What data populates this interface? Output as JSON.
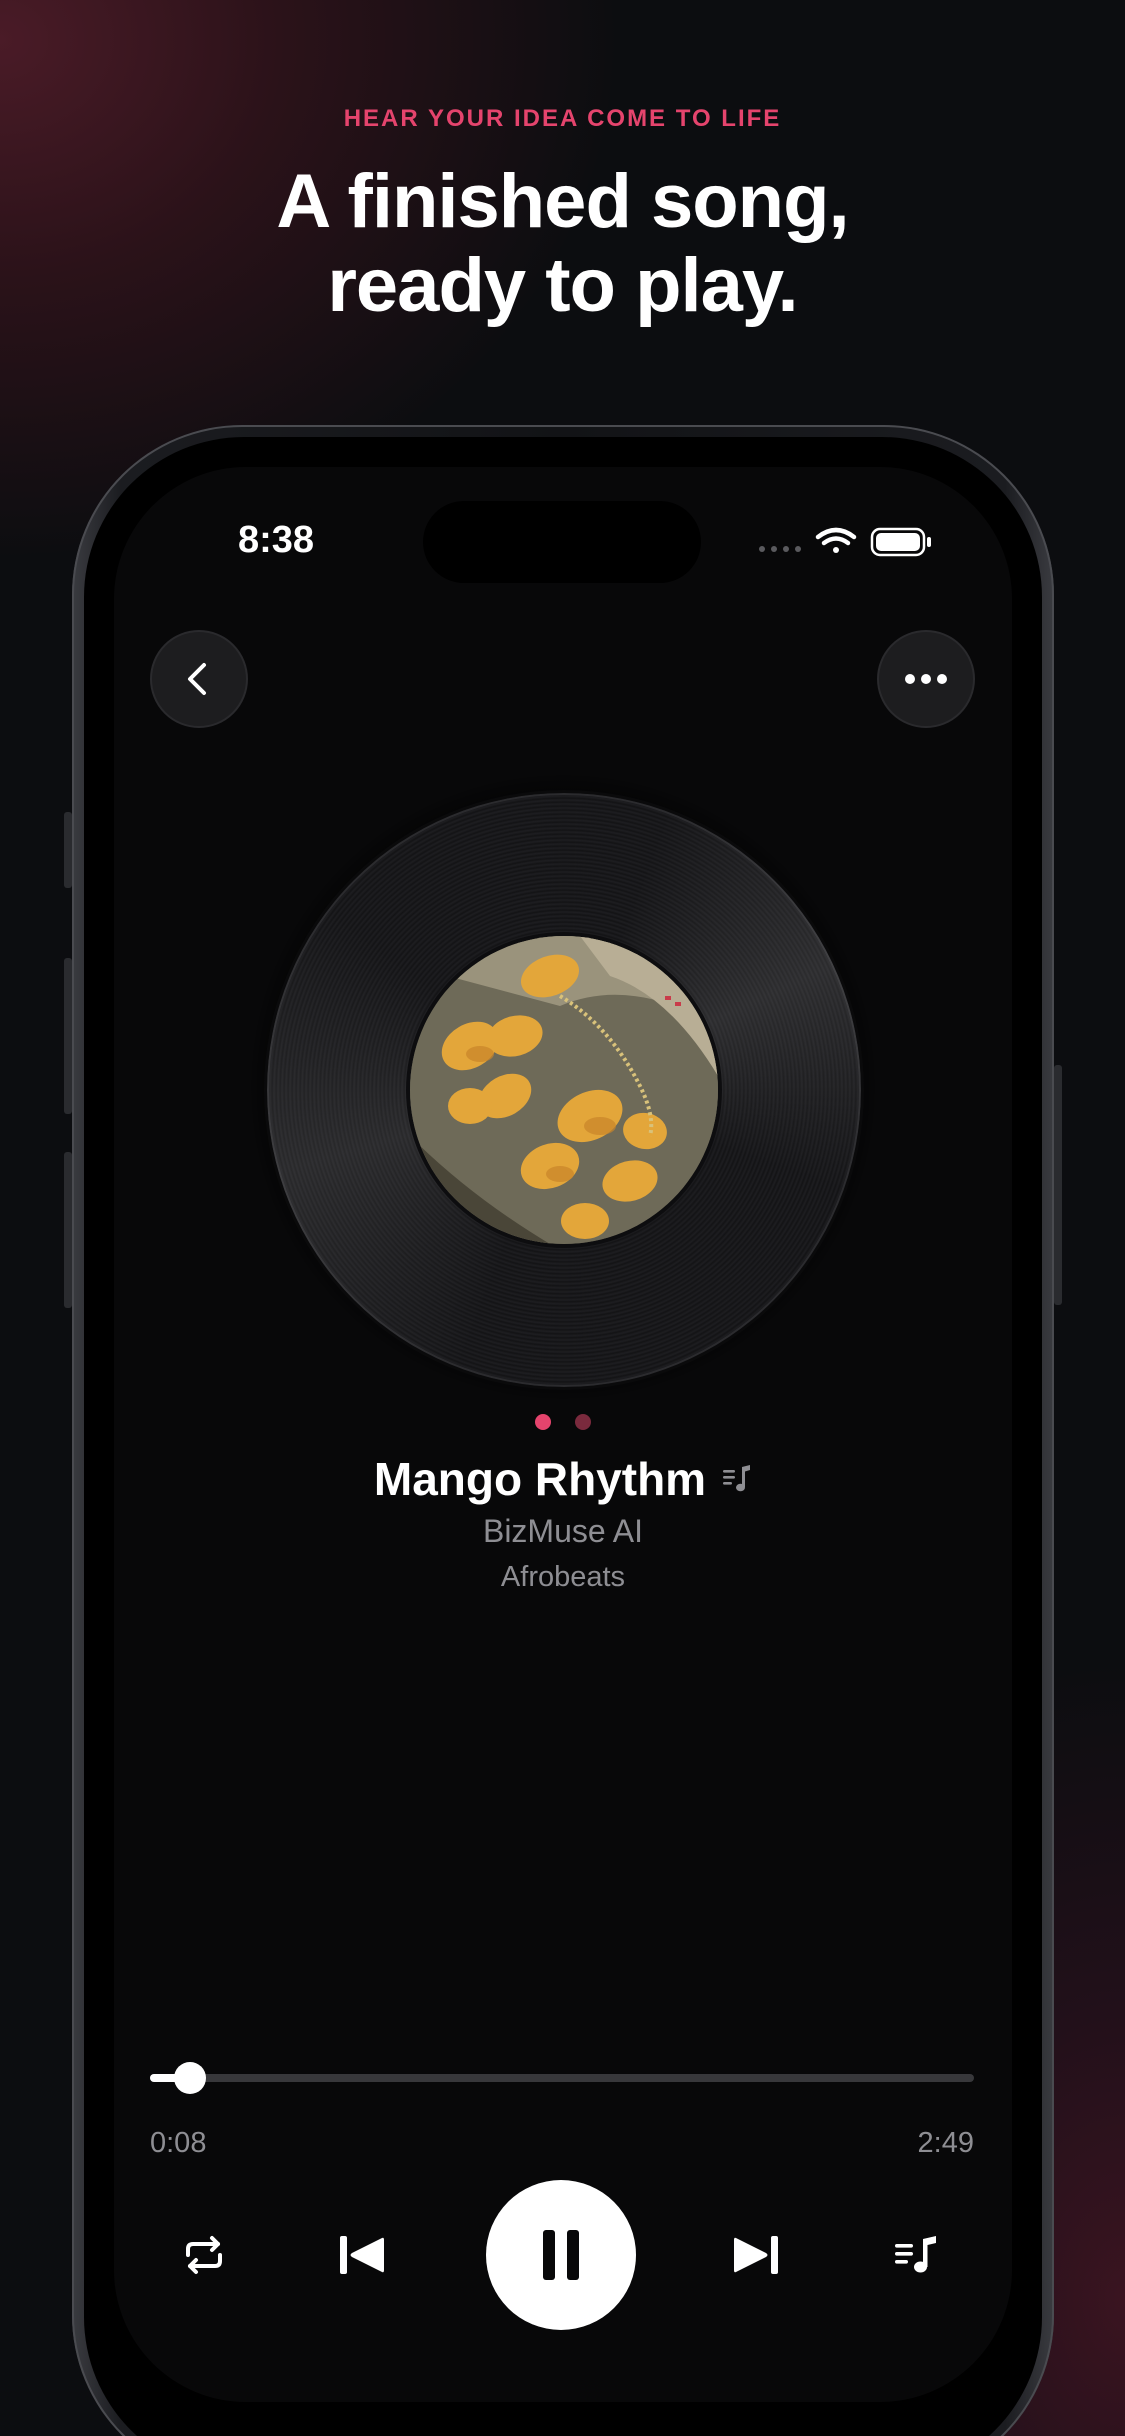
{
  "promo": {
    "eyebrow": "HEAR YOUR IDEA COME TO LIFE",
    "headline_line1": "A finished song,",
    "headline_line2": "ready to play."
  },
  "status_bar": {
    "time": "8:38",
    "icons": [
      "cellular-dots-icon",
      "wifi-icon",
      "battery-icon"
    ]
  },
  "nav": {
    "back_icon": "chevron-left-icon",
    "more_icon": "ellipsis-icon"
  },
  "player": {
    "page_dots": {
      "count": 2,
      "active_index": 0
    },
    "title": "Mango Rhythm",
    "title_icon": "music-queue-icon",
    "artist": "BizMuse AI",
    "genre": "Afrobeats",
    "elapsed": "0:08",
    "duration": "2:49",
    "progress_fraction": 0.048
  },
  "controls": [
    "repeat-icon",
    "previous-icon",
    "pause-icon",
    "next-icon",
    "queue-icon"
  ],
  "colors": {
    "accent": "#e5446d",
    "accent_dim": "#7a2a3d",
    "background": "#0c0d10",
    "screen": "#080809",
    "secondary_text": "#8e8e93"
  }
}
